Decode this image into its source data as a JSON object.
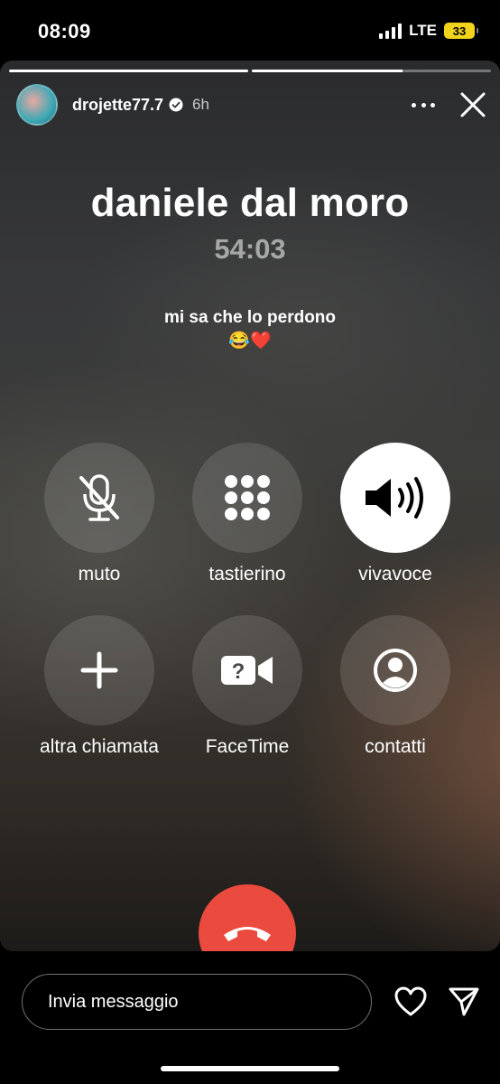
{
  "status_bar": {
    "time": "08:09",
    "network": "LTE",
    "battery": "33"
  },
  "story": {
    "username": "drojette77.7",
    "age": "6h",
    "progress": [
      1.0,
      0.63
    ]
  },
  "call": {
    "caller_name": "daniele dal moro",
    "duration": "54:03",
    "caption_line1": "mi sa che lo perdono",
    "caption_line2": "😂❤️"
  },
  "buttons": {
    "mute": "muto",
    "keypad": "tastierino",
    "speaker": "vivavoce",
    "add_call": "altra chiamata",
    "facetime": "FaceTime",
    "contacts": "contatti"
  },
  "reply": {
    "placeholder": "Invia messaggio"
  },
  "icons": [
    "verified-icon",
    "more-icon",
    "close-icon",
    "mic-off-icon",
    "keypad-icon",
    "speaker-icon",
    "plus-icon",
    "facetime-icon",
    "contact-icon",
    "end-call-icon",
    "heart-icon",
    "send-icon"
  ]
}
